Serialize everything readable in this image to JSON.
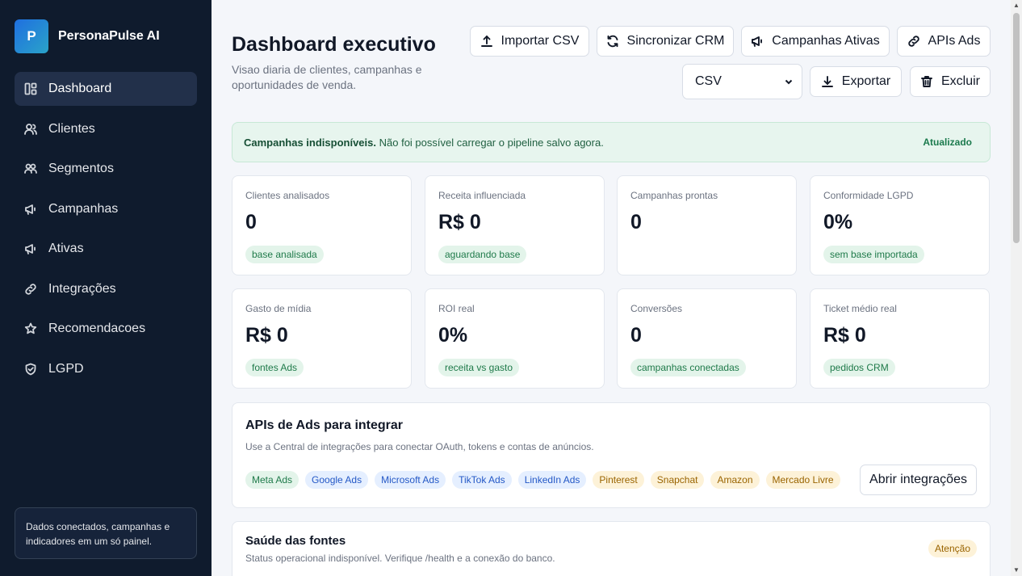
{
  "brand": {
    "logo_letter": "P",
    "name": "PersonaPulse AI"
  },
  "sidebar": {
    "items": [
      {
        "label": "Dashboard",
        "icon": "dashboard-icon",
        "active": true
      },
      {
        "label": "Clientes",
        "icon": "users-icon"
      },
      {
        "label": "Segmentos",
        "icon": "group-icon"
      },
      {
        "label": "Campanhas",
        "icon": "megaphone-icon"
      },
      {
        "label": "Ativas",
        "icon": "megaphone-icon"
      },
      {
        "label": "Integrações",
        "icon": "link-icon"
      },
      {
        "label": "Recomendacoes",
        "icon": "star-icon"
      },
      {
        "label": "LGPD",
        "icon": "shield-icon"
      }
    ],
    "note": "Dados conectados, campanhas e indicadores em um só painel."
  },
  "header": {
    "title": "Dashboard executivo",
    "subtitle": "Visao diaria de clientes, campanhas e oportunidades de venda.",
    "buttons": {
      "import_csv": "Importar CSV",
      "sync_crm": "Sincronizar CRM",
      "active_campaigns": "Campanhas Ativas",
      "apis_ads": "APIs Ads",
      "export": "Exportar",
      "delete": "Excluir"
    },
    "format_select": {
      "value": "CSV"
    }
  },
  "alert": {
    "title": "Campanhas indisponíveis.",
    "message": "Não foi possível carregar o pipeline salvo agora.",
    "status": "Atualizado"
  },
  "metrics": [
    {
      "label": "Clientes analisados",
      "value": "0",
      "badge": "base analisada"
    },
    {
      "label": "Receita influenciada",
      "value": "R$ 0",
      "badge": "aguardando base"
    },
    {
      "label": "Campanhas prontas",
      "value": "0",
      "badge": ""
    },
    {
      "label": "Conformidade LGPD",
      "value": "0%",
      "badge": "sem base importada"
    },
    {
      "label": "Gasto de mídia",
      "value": "R$ 0",
      "badge": "fontes Ads"
    },
    {
      "label": "ROI real",
      "value": "0%",
      "badge": "receita vs gasto"
    },
    {
      "label": "Conversões",
      "value": "0",
      "badge": "campanhas conectadas"
    },
    {
      "label": "Ticket médio real",
      "value": "R$ 0",
      "badge": "pedidos CRM"
    }
  ],
  "ads_panel": {
    "title": "APIs de Ads para integrar",
    "subtitle": "Use a Central de integrações para conectar OAuth, tokens e contas de anúncios.",
    "chips": [
      {
        "label": "Meta Ads",
        "color": "green"
      },
      {
        "label": "Google Ads",
        "color": "blue"
      },
      {
        "label": "Microsoft Ads",
        "color": "blue"
      },
      {
        "label": "TikTok Ads",
        "color": "blue"
      },
      {
        "label": "LinkedIn Ads",
        "color": "blue"
      },
      {
        "label": "Pinterest",
        "color": "yellow"
      },
      {
        "label": "Snapchat",
        "color": "yellow"
      },
      {
        "label": "Amazon",
        "color": "yellow"
      },
      {
        "label": "Mercado Livre",
        "color": "yellow"
      }
    ],
    "open_button": "Abrir integrações"
  },
  "health_panel": {
    "title": "Saúde das fontes",
    "subtitle": "Status operacional indisponível. Verifique /health e a conexão do banco.",
    "badge": "Atenção"
  },
  "colors": {
    "sidebar_bg": "#0f1b2d",
    "accent": "#1f6fe0",
    "success": "#1f7a4a",
    "warning": "#9a6400"
  }
}
